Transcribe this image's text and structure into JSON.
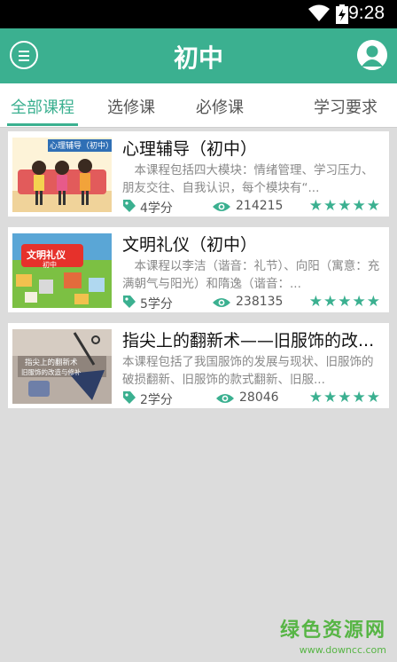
{
  "status_bar": {
    "time": "9:28"
  },
  "app_bar": {
    "title": "初中",
    "menu_icon": "menu-icon",
    "profile_icon": "user-avatar-icon"
  },
  "tabs": [
    {
      "label": "全部课程",
      "active": true
    },
    {
      "label": "选修课",
      "active": false
    },
    {
      "label": "必修课",
      "active": false
    },
    {
      "label": "学习要求",
      "active": false
    }
  ],
  "courses": [
    {
      "title": "心理辅导（初中）",
      "description": "　本课程包括四大模块：情绪管理、学习压力、朋友交往、自我认识，每个模块有“...",
      "credits": "4学分",
      "views": "214215",
      "stars": "★★★★★",
      "thumb_text": "心理辅导（初中）"
    },
    {
      "title": "文明礼仪（初中）",
      "description": "　本课程以李洁（谐音：礼节）、向阳（寓意：充满朝气与阳光）和隋逸（谐音：...",
      "credits": "5学分",
      "views": "238135",
      "stars": "★★★★★",
      "thumb_text": "文明礼仪",
      "thumb_subtext": "初中"
    },
    {
      "title": "指尖上的翻新术——旧服饰的改...",
      "description": "本课程包括了我国服饰的发展与现状、旧服饰的破损翻新、旧服饰的款式翻新、旧服...",
      "credits": "2学分",
      "views": "28046",
      "stars": "★★★★★",
      "thumb_text": "指尖上的翻新术",
      "thumb_subtext": "旧服饰的改造与修补"
    }
  ],
  "watermark": {
    "main": "绿色资源网",
    "url": "www.downcc.com"
  },
  "colors": {
    "accent": "#3bb090",
    "background": "#dcdcdc",
    "watermark": "#57b545"
  }
}
